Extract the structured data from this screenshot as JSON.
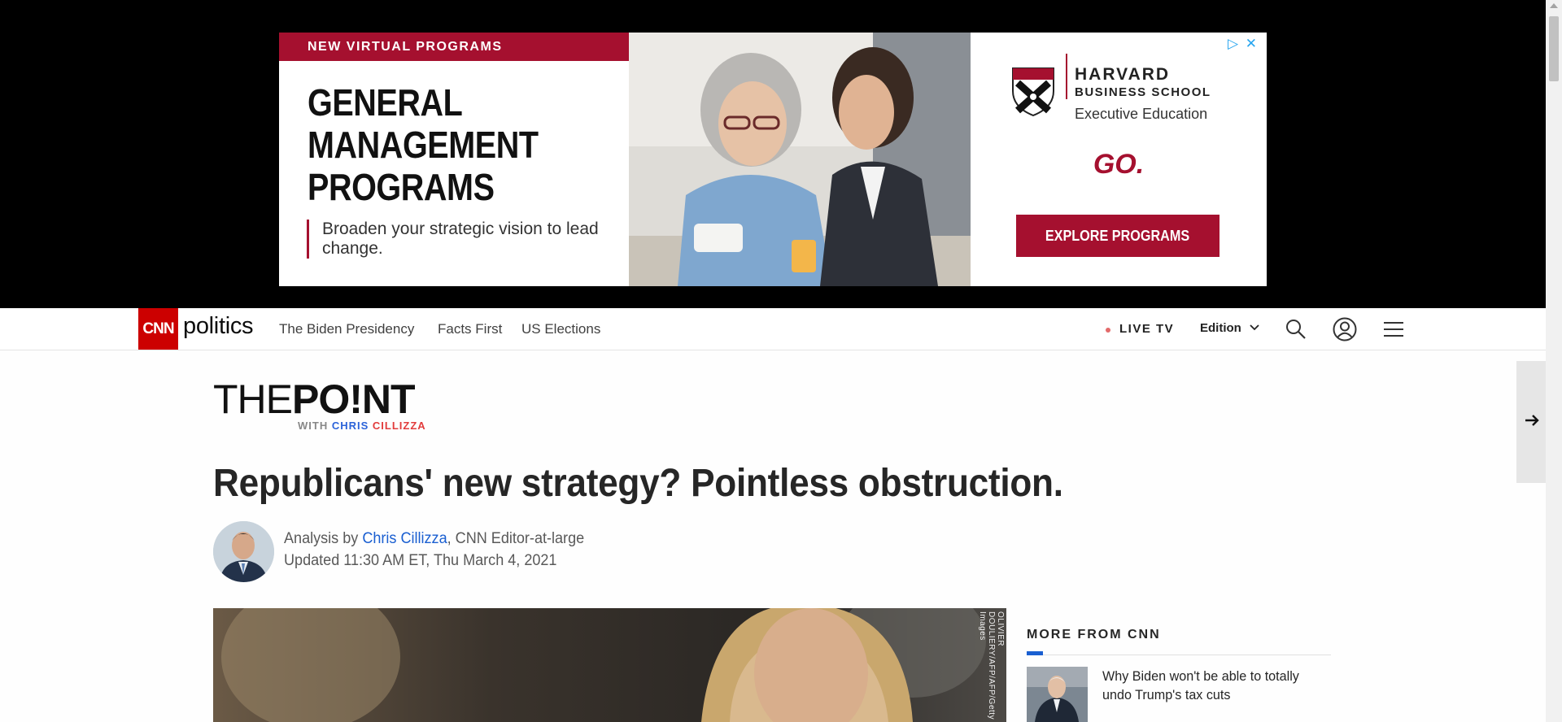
{
  "ad": {
    "tag": "NEW VIRTUAL PROGRAMS",
    "headline_lines": [
      "GENERAL",
      "MANAGEMENT",
      "PROGRAMS"
    ],
    "subtext": "Broaden your strategic vision to lead change.",
    "brand_name": "HARVARD",
    "brand_school": "BUSINESS SCHOOL",
    "brand_unit": "Executive Education",
    "go": "GO.",
    "cta": "EXPLORE PROGRAMS",
    "adchoices_icon": "adchoices-icon",
    "close_icon": "close-icon",
    "accent_color": "#a5102f"
  },
  "nav": {
    "logo": "CNN",
    "section": "politics",
    "links": [
      "The Biden Presidency",
      "Facts First",
      "US Elections"
    ],
    "live_tv": "LIVE TV",
    "edition": "Edition",
    "icons": [
      "search-icon",
      "account-icon",
      "menu-icon"
    ],
    "brand_color": "#cc0000"
  },
  "article": {
    "series_logo": {
      "the": "THE",
      "point": "PO!NT",
      "with": "WITH",
      "name_first": "CHRIS",
      "name_last": "CILLIZZA"
    },
    "headline": "Republicans' new strategy? Pointless obstruction.",
    "byline_prefix": "Analysis by",
    "author": "Chris Cillizza",
    "author_role": ", CNN Editor-at-large",
    "updated": "Updated 11:30 AM ET, Thu March 4, 2021",
    "hero_credit": "OLIVIER DOULIERY/AFP/AFP/Getty Images",
    "link_color": "#1a5fd1"
  },
  "more_from_cnn": {
    "title": "MORE FROM CNN",
    "items": [
      {
        "text": "Why Biden won't be able to totally undo Trump's tax cuts"
      }
    ]
  }
}
